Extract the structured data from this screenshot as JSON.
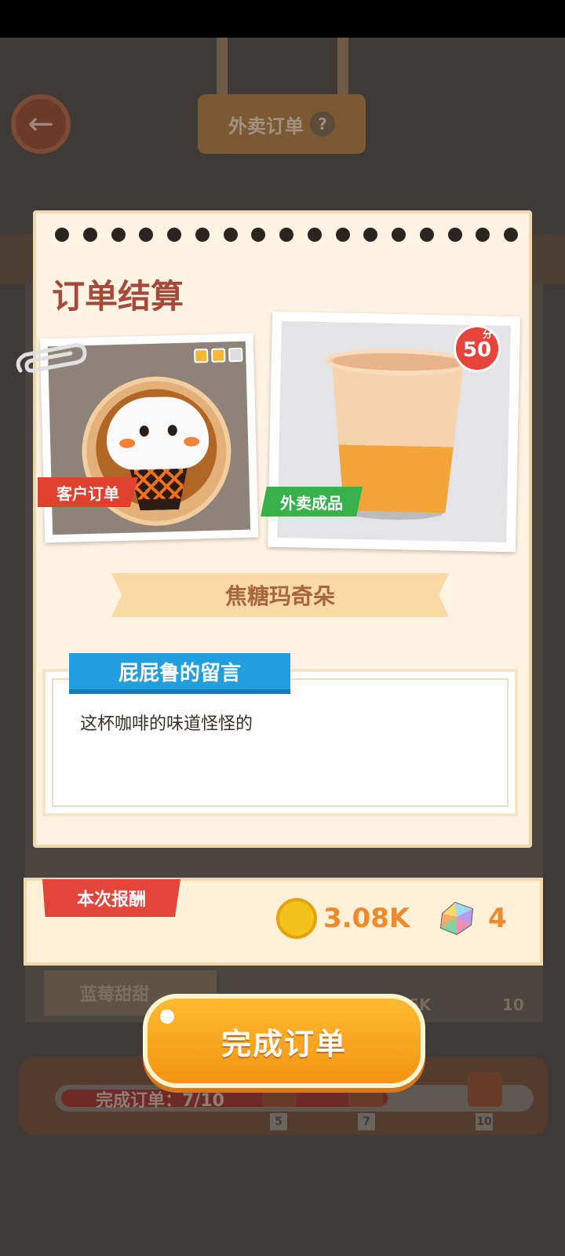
{
  "background": {
    "back_icon": "arrow-left-icon",
    "header_title": "外卖订单",
    "header_help": "?",
    "list_item_label": "蓝莓甜甜",
    "list_item_coin_value": "6K",
    "list_item_gem_value": "10",
    "progress": {
      "label": "完成订单：7/10",
      "fraction": 0.7,
      "milestones": [
        "5",
        "7",
        "10"
      ]
    }
  },
  "dialog": {
    "title": "订单结算",
    "customer_tag": "客户订单",
    "product_tag": "外卖成品",
    "score": {
      "value": "50",
      "unit": "分"
    },
    "gifts_earned": 2,
    "gifts_total": 3,
    "item_name": "焦糖玛奇朵",
    "message_title": "屁屁鲁的留言",
    "message_text": "这杯咖啡的味道怪怪的",
    "reward": {
      "label": "本次报酬",
      "coins": "3.08K",
      "gems": "4"
    },
    "complete_button": "完成订单"
  },
  "colors": {
    "accent_orange": "#f49311",
    "title_red": "#a54a3a",
    "tag_red": "#e0412e",
    "tag_green": "#38b14a",
    "message_blue": "#1f9fdd"
  }
}
